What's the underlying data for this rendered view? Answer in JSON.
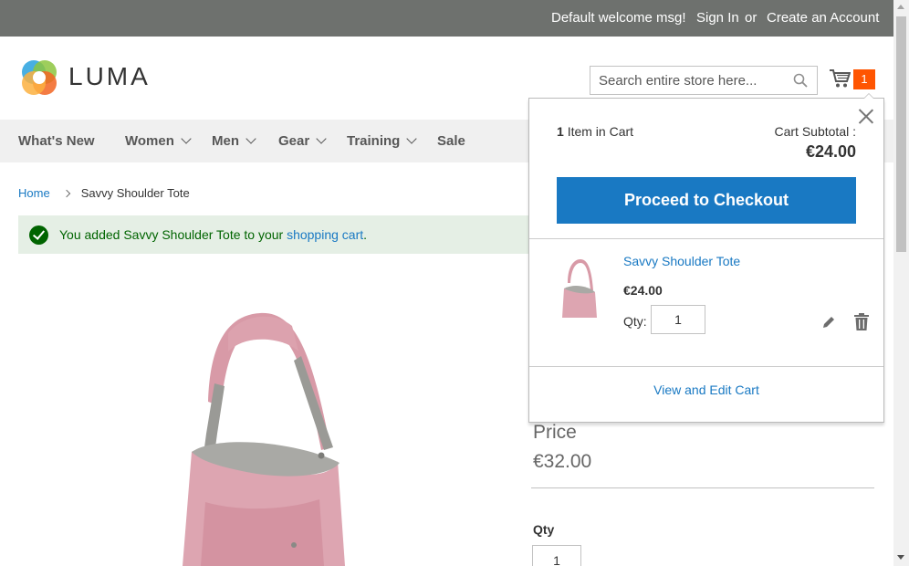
{
  "top_bar": {
    "welcome": "Default welcome msg!",
    "sign_in": "Sign In",
    "or": "or",
    "create_account": "Create an Account"
  },
  "header": {
    "logo_text": "LUMA",
    "search_placeholder": "Search entire store here...",
    "cart_count": "1"
  },
  "nav": {
    "items": [
      {
        "label": "What's New"
      },
      {
        "label": "Women"
      },
      {
        "label": "Men"
      },
      {
        "label": "Gear"
      },
      {
        "label": "Training"
      },
      {
        "label": "Sale"
      }
    ]
  },
  "breadcrumb": {
    "home": "Home",
    "current": "Savvy Shoulder Tote"
  },
  "message": {
    "prefix": "You added Savvy Shoulder Tote to your",
    "link": "shopping cart",
    "suffix": "."
  },
  "product": {
    "price_label": "Price",
    "price": "€32.00",
    "qty_label": "Qty",
    "qty": "1"
  },
  "minicart": {
    "item_count": "1",
    "item_count_suffix": "Item in Cart",
    "subtotal_label": "Cart Subtotal :",
    "subtotal": "€24.00",
    "checkout_label": "Proceed to Checkout",
    "item": {
      "name": "Savvy Shoulder Tote",
      "price": "€24.00",
      "qty_label": "Qty:",
      "qty": "1"
    },
    "view_edit": "View and Edit Cart"
  },
  "colors": {
    "top_bar": "#6e716e",
    "accent_blue": "#1979c3",
    "counter_orange": "#ff5501",
    "success_bg": "#e5efe5",
    "success_text": "#006400"
  }
}
